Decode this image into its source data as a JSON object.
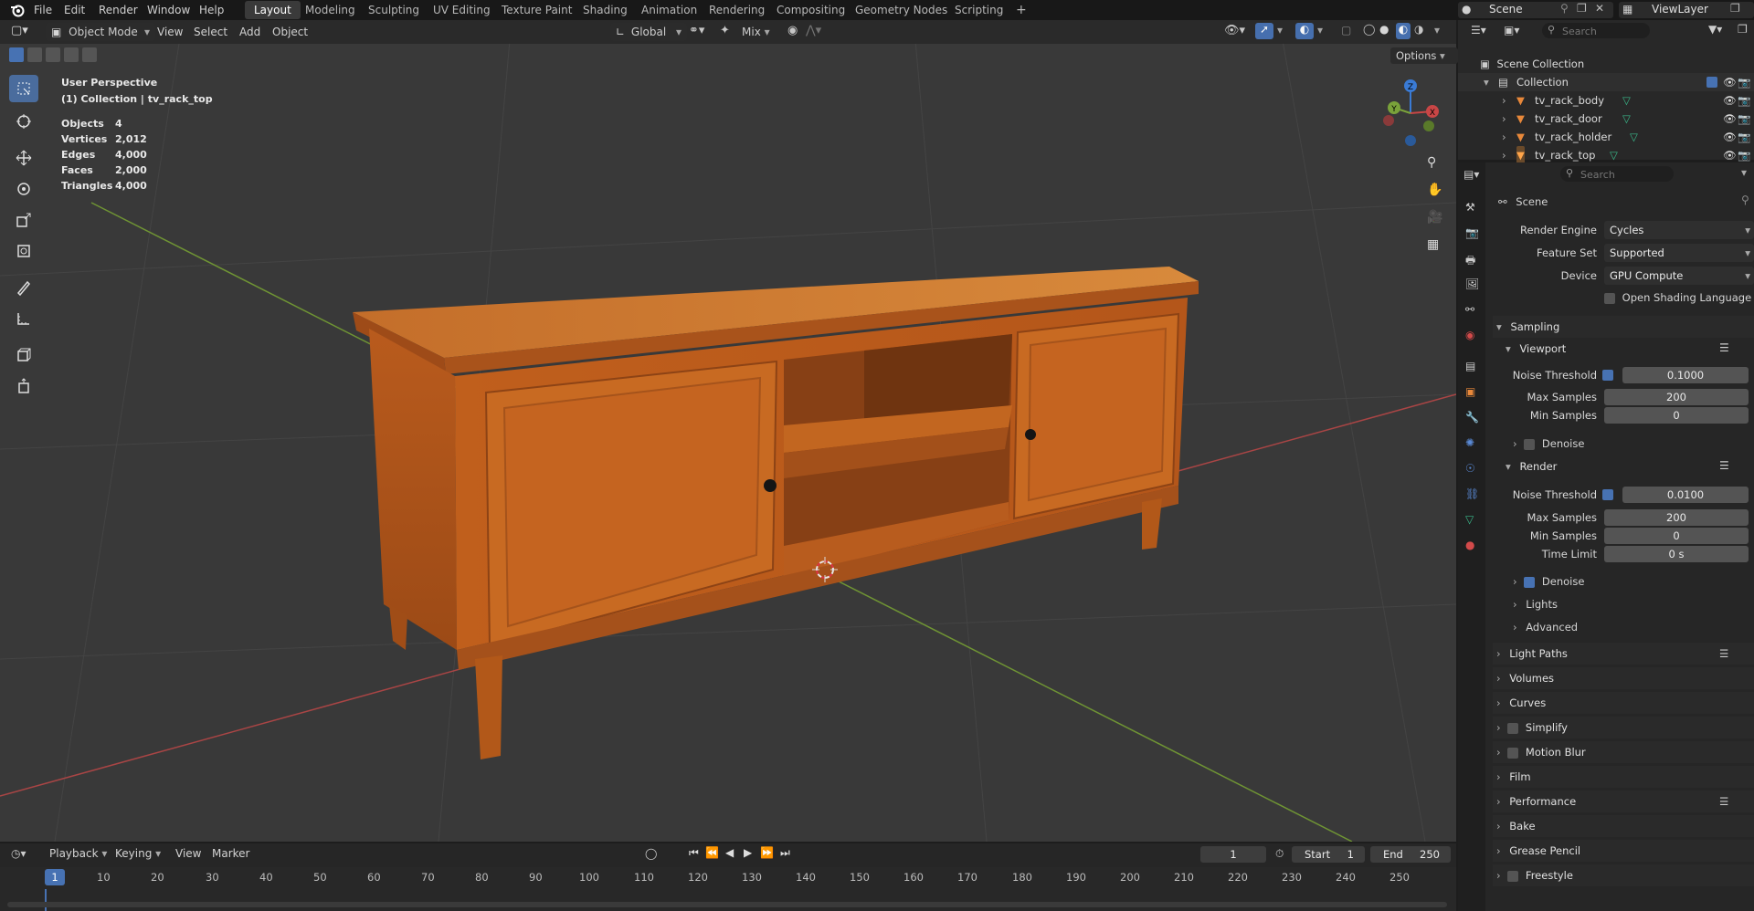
{
  "menubar": {
    "items": [
      "File",
      "Edit",
      "Render",
      "Window",
      "Help"
    ],
    "workspaces": [
      "Layout",
      "Modeling",
      "Sculpting",
      "UV Editing",
      "Texture Paint",
      "Shading",
      "Animation",
      "Rendering",
      "Compositing",
      "Geometry Nodes",
      "Scripting"
    ],
    "plus": "+",
    "scene_name": "Scene",
    "view_layer": "ViewLayer"
  },
  "viewport_header": {
    "mode": "Object Mode",
    "menus": [
      "View",
      "Select",
      "Add",
      "Object"
    ],
    "transform": "Global",
    "snap": "Mix",
    "options": "Options"
  },
  "overlay": {
    "perspective": "User Perspective",
    "collection_line": "(1) Collection | tv_rack_top",
    "stats": [
      {
        "label": "Objects",
        "value": "4"
      },
      {
        "label": "Vertices",
        "value": "2,012"
      },
      {
        "label": "Edges",
        "value": "4,000"
      },
      {
        "label": "Faces",
        "value": "2,000"
      },
      {
        "label": "Triangles",
        "value": "4,000"
      }
    ]
  },
  "gizmo": {
    "x": "X",
    "y": "Y",
    "z": "Z"
  },
  "outliner": {
    "search_placeholder": "Search",
    "root": "Scene Collection",
    "collection": "Collection",
    "objects": [
      "tv_rack_body",
      "tv_rack_door",
      "tv_rack_holder",
      "tv_rack_top"
    ]
  },
  "properties": {
    "search_placeholder": "Search",
    "context": "Scene",
    "render_engine_label": "Render Engine",
    "render_engine": "Cycles",
    "feature_set_label": "Feature Set",
    "feature_set": "Supported",
    "device_label": "Device",
    "device": "GPU Compute",
    "osl_label": "Open Shading Language",
    "sampling": "Sampling",
    "viewport": "Viewport",
    "render": "Render",
    "noise_threshold_label": "Noise Threshold",
    "viewport_noise_threshold": "0.1000",
    "max_samples_label": "Max Samples",
    "viewport_max_samples": "200",
    "min_samples_label": "Min Samples",
    "viewport_min_samples": "0",
    "denoise_label": "Denoise",
    "render_noise_threshold": "0.0100",
    "render_max_samples": "200",
    "render_min_samples": "0",
    "time_limit_label": "Time Limit",
    "time_limit": "0 s",
    "lights": "Lights",
    "advanced": "Advanced",
    "panels": [
      "Light Paths",
      "Volumes",
      "Curves",
      "Simplify",
      "Motion Blur",
      "Film",
      "Performance",
      "Bake",
      "Grease Pencil",
      "Freestyle"
    ]
  },
  "timeline": {
    "menus": [
      "Playback",
      "Keying",
      "View",
      "Marker"
    ],
    "current_frame": "1",
    "start_label": "Start",
    "start": "1",
    "end_label": "End",
    "end": "250",
    "ticks": [
      "1",
      "10",
      "20",
      "30",
      "40",
      "50",
      "60",
      "70",
      "80",
      "90",
      "100",
      "110",
      "120",
      "130",
      "140",
      "150",
      "160",
      "170",
      "180",
      "190",
      "200",
      "210",
      "220",
      "230",
      "240",
      "250"
    ]
  },
  "colors": {
    "accent": "#4772b3",
    "viewport_bg": "#393939",
    "wood_light": "#d27a2c",
    "wood_dark": "#8c4414",
    "x_axis": "#c84646",
    "y_axis": "#7aa23a"
  }
}
